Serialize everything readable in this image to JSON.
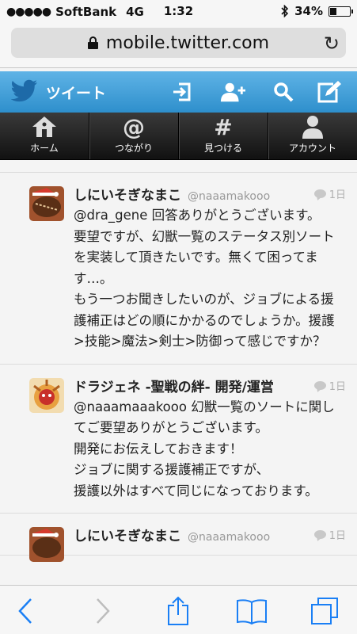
{
  "status_bar": {
    "carrier": "SoftBank",
    "network": "4G",
    "time": "1:32",
    "battery": "34%",
    "battery_level": 0.34
  },
  "browser": {
    "url": "mobile.twitter.com"
  },
  "header": {
    "title": "ツイート",
    "icons": [
      "twitter-bird-icon",
      "sign-in-icon",
      "add-user-icon",
      "search-icon",
      "compose-icon"
    ]
  },
  "nav": {
    "items": [
      {
        "label": "ホーム",
        "icon": "home-icon"
      },
      {
        "label": "つながり",
        "icon": "at-icon"
      },
      {
        "label": "見つける",
        "icon": "hash-icon"
      },
      {
        "label": "アカウント",
        "icon": "person-icon"
      }
    ]
  },
  "tweets": [
    {
      "name": "しにいそぎなまこ",
      "handle": "@naaamakooo",
      "time": "1日",
      "text": "@dra_gene 回答ありがとうございます。\n要望ですが、幻獣一覧のステータス別ソートを実装して頂きたいです。無くて困ってます…。\nもう一つお聞きしたいのが、ジョブによる援護補正はどの順にかかるのでしょうか。援護>技能>魔法>剣士>防御って感じですか？"
    },
    {
      "name": "ドラジェネ -聖戦の絆- 開発/運営",
      "handle": "",
      "time": "1日",
      "text": "@naaamaaakooo 幻獣一覧のソートに関してご要望ありがとうございます。\n開発にお伝えしておきます！\nジョブに関する援護補正ですが、\n援護以外はすべて同じになっております。"
    },
    {
      "name": "しにいそぎなまこ",
      "handle": "@naaamakooo",
      "time": "1日",
      "text": ""
    }
  ]
}
